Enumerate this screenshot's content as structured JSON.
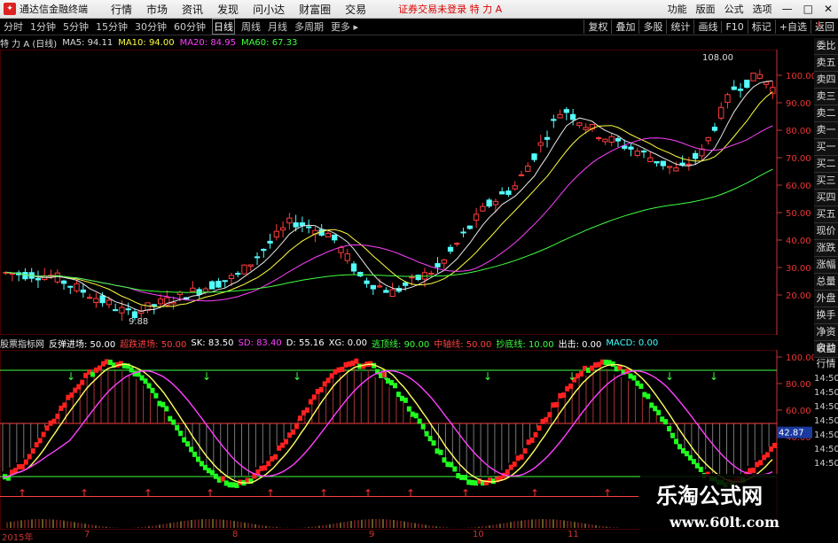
{
  "menubar": {
    "app_name": "通达信金融终端",
    "items": [
      "行情",
      "市场",
      "资讯",
      "发现",
      "问小达",
      "财富圈",
      "交易"
    ],
    "status": "证券交易未登录  特 力 A",
    "right_items": [
      "功能",
      "版面",
      "公式",
      "选项"
    ],
    "window_buttons": [
      "—",
      "□",
      "✕"
    ]
  },
  "toolbar": {
    "periods": [
      "分时",
      "1分钟",
      "5分钟",
      "15分钟",
      "30分钟",
      "60分钟",
      "日线",
      "周线",
      "月线",
      "多周期",
      "更多 ▸"
    ],
    "active_index": 6,
    "right_buttons": [
      "复权",
      "叠加",
      "多股",
      "统计",
      "画线",
      "F10",
      "标记",
      "+自选",
      "返回"
    ]
  },
  "main_info": {
    "stock": "特 力 A (日线)",
    "ma5": "MA5: 94.11",
    "ma10": "MA10: 94.00",
    "ma20": "MA20: 84.95",
    "ma60": "MA60: 67.33"
  },
  "price_axis": [
    "100.00",
    "90.00",
    "80.00",
    "70.00",
    "60.00",
    "50.00",
    "40.00",
    "30.00",
    "20.00"
  ],
  "price_labels": {
    "high": "108.00",
    "low": "9.88"
  },
  "indicator_info": {
    "name": "股票指标网",
    "items": [
      {
        "text": "反弹进场: 50.00",
        "color": "#fff"
      },
      {
        "text": "超跌进场: 50.00",
        "color": "#ff4040"
      },
      {
        "text": "SK: 83.50",
        "color": "#fff"
      },
      {
        "text": "SD: 83.40",
        "color": "#ff40ff"
      },
      {
        "text": "D: 55.16",
        "color": "#fff"
      },
      {
        "text": "XG: 0.00",
        "color": "#fff"
      },
      {
        "text": "逃顶线: 90.00",
        "color": "#40ff40"
      },
      {
        "text": "中轴线: 50.00",
        "color": "#ff4040"
      },
      {
        "text": "抄底线: 10.00",
        "color": "#40ff40"
      },
      {
        "text": "出击: 0.00",
        "color": "#fff"
      },
      {
        "text": "MACD: 0.00",
        "color": "#40ffff"
      }
    ]
  },
  "ind_axis": [
    "100.00",
    "80.00",
    "60.00",
    "40.00"
  ],
  "ind_value_label": "42.87",
  "right_panel": [
    "委比",
    "卖五",
    "卖四",
    "卖三",
    "卖二",
    "卖一",
    "买一",
    "买二",
    "买三",
    "买四",
    "买五",
    "现价",
    "涨跌",
    "涨幅",
    "总量",
    "外盘",
    "换手",
    "净资",
    "收益"
  ],
  "right_panel2": [
    "自动",
    "行情"
  ],
  "hot_times": [
    "14:50",
    "14:50",
    "14:50",
    "14:50",
    "14:50",
    "14:50",
    "14:50"
  ],
  "dates": [
    "2015年",
    "7",
    "8",
    "9",
    "10",
    "11"
  ],
  "watermark": {
    "cn": "乐淘公式网",
    "url": "www.60lt.com"
  },
  "corner": "L"
}
